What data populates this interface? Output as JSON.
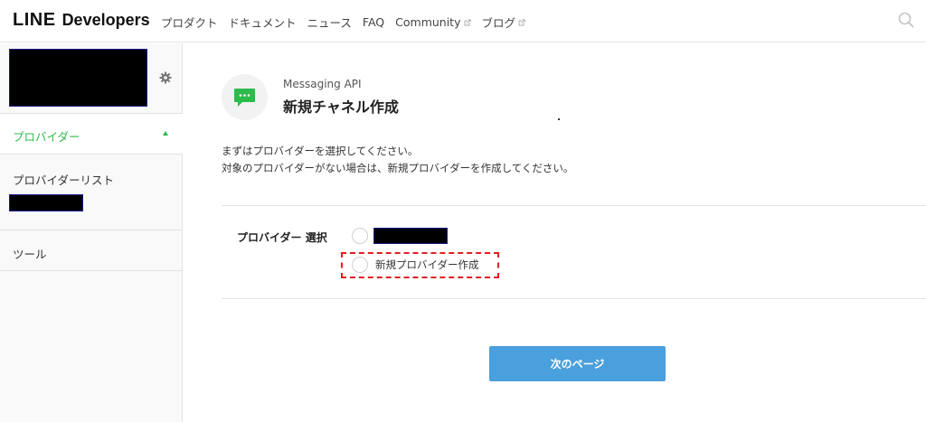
{
  "header": {
    "logo_line": "LINE",
    "logo_dev": "Developers",
    "nav": [
      {
        "label": "プロダクト",
        "external": false
      },
      {
        "label": "ドキュメント",
        "external": false
      },
      {
        "label": "ニュース",
        "external": false
      },
      {
        "label": "FAQ",
        "external": false
      },
      {
        "label": "Community",
        "external": true
      },
      {
        "label": "ブログ",
        "external": true
      }
    ],
    "search_icon": "search-icon"
  },
  "sidebar": {
    "settings_icon": "gear-icon",
    "provider_section": "プロバイダー",
    "provider_list": "プロバイダーリスト",
    "tools": "ツール",
    "accent_color": "#2dbb4b"
  },
  "main": {
    "api_name": "Messaging API",
    "title": "新規チャネル作成",
    "desc_line1": "まずはプロバイダーを選択してください。",
    "desc_line2": "対象のプロバイダーがない場合は、新規プロバイダーを作成してください。",
    "provider_select_label": "プロバイダー 選択",
    "new_provider_option": "新規プロバイダー作成",
    "next_button": "次のページ",
    "button_color": "#4a9fdd",
    "icon_color": "#2dbb4b"
  }
}
